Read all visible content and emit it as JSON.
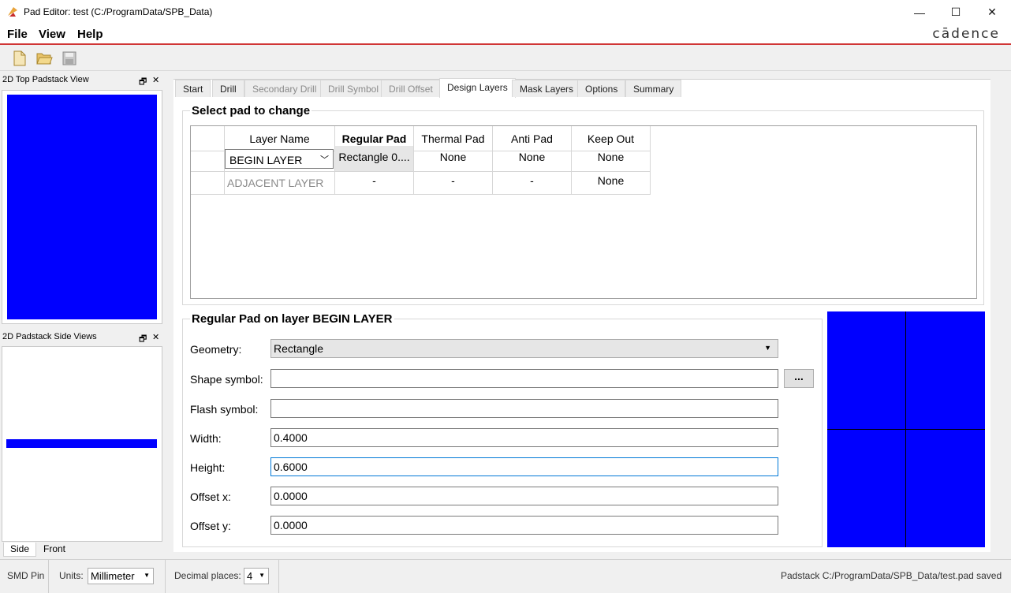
{
  "window": {
    "title": "Pad Editor: test  (C:/ProgramData/SPB_Data)",
    "minimize_glyph": "—",
    "maximize_glyph": "☐",
    "close_glyph": "✕"
  },
  "menu": {
    "file": "File",
    "view": "View",
    "help": "Help",
    "brand": "cādence"
  },
  "toolbar": {
    "icons": [
      "new-file-icon",
      "open-folder-icon",
      "save-disk-icon"
    ]
  },
  "dock": {
    "top_view_title": "2D Top Padstack View",
    "side_views_title": "2D Padstack Side Views",
    "float_glyph": "🗗",
    "close_glyph": "✕",
    "side_tabs": [
      "Side",
      "Front"
    ]
  },
  "tabs": [
    "Start",
    "Drill",
    "Secondary Drill",
    "Drill Symbol",
    "Drill Offset",
    "Design Layers",
    "Mask Layers",
    "Options",
    "Summary"
  ],
  "select_pad": {
    "title": "Select pad to change",
    "headers": [
      "Layer Name",
      "Regular Pad",
      "Thermal Pad",
      "Anti Pad",
      "Keep Out"
    ],
    "rows": [
      {
        "layer": "BEGIN LAYER",
        "regular": "Rectangle 0....",
        "thermal": "None",
        "anti": "None",
        "keepout": "None"
      },
      {
        "layer": "ADJACENT LAYER",
        "regular": "-",
        "thermal": "-",
        "anti": "-",
        "keepout": "None"
      }
    ]
  },
  "pad_form": {
    "title": "Regular Pad on layer BEGIN LAYER",
    "geometry_label": "Geometry:",
    "geometry_value": "Rectangle",
    "shape_label": "Shape symbol:",
    "shape_value": "",
    "browse_label": "...",
    "flash_label": "Flash symbol:",
    "flash_value": "",
    "width_label": "Width:",
    "width_value": "0.4000",
    "height_label": "Height:",
    "height_value": "0.6000",
    "offx_label": "Offset x:",
    "offx_value": "0.0000",
    "offy_label": "Offset y:",
    "offy_value": "0.0000"
  },
  "colors": {
    "pad": "#0000ff",
    "accent_line": "#d03636"
  },
  "status": {
    "pin_type": "SMD Pin",
    "units_label": "Units:",
    "units_value": "Millimeter",
    "decimal_label": "Decimal places:",
    "decimal_value": "4",
    "message": "Padstack C:/ProgramData/SPB_Data/test.pad saved"
  }
}
